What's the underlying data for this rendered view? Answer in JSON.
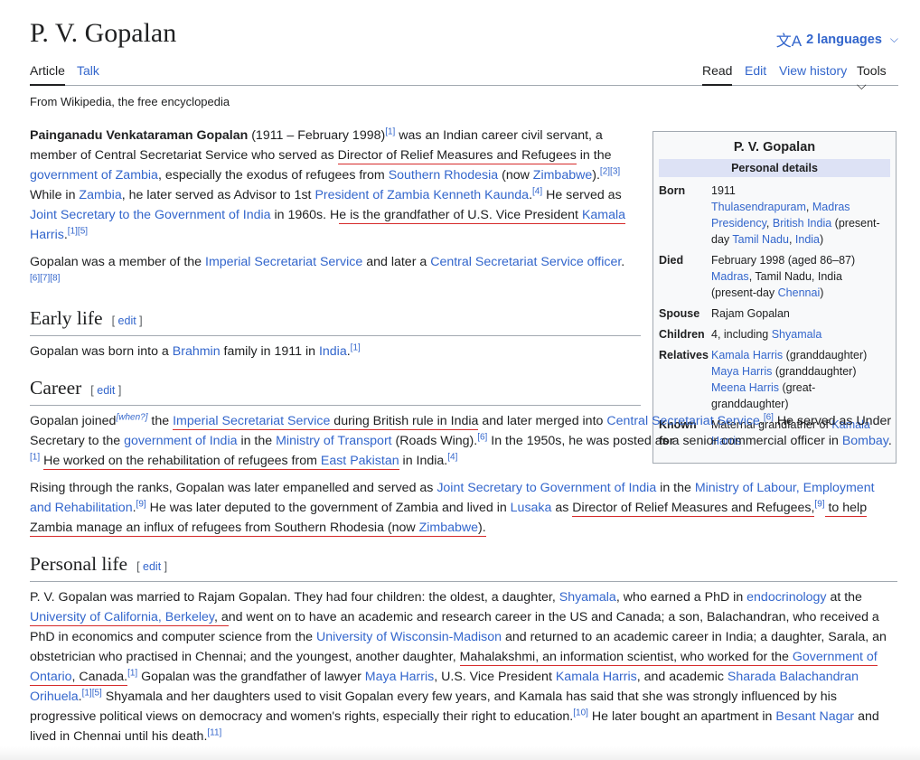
{
  "page": {
    "title": "P. V. Gopalan",
    "languages": "2 languages",
    "tagline": "From Wikipedia, the free encyclopedia"
  },
  "tabs": {
    "article": "Article",
    "talk": "Talk",
    "read": "Read",
    "edit": "Edit",
    "history": "View history",
    "tools": "Tools"
  },
  "lead": {
    "p1": [
      {
        "t": "Painganadu Venkataraman Gopalan",
        "b": true
      },
      {
        "t": " (1911 – February 1998)"
      },
      {
        "t": "[1]",
        "sup": true
      },
      {
        "t": " was an Indian career civil servant, a member of Central Secretariat Service who served as "
      },
      {
        "t": "Director of Relief Measures and Refugees",
        "u": true
      },
      {
        "t": " in the "
      },
      {
        "t": "government of Zambia",
        "l": true
      },
      {
        "t": ", especially the exodus of refugees from "
      },
      {
        "t": "Southern Rhodesia",
        "l": true
      },
      {
        "t": " (now "
      },
      {
        "t": "Zimbabwe",
        "l": true
      },
      {
        "t": ")."
      },
      {
        "t": "[2][3]",
        "sup": true
      },
      {
        "t": " While in "
      },
      {
        "t": "Zambia",
        "l": true
      },
      {
        "t": ", he later served as Advisor to 1st "
      },
      {
        "t": "President of Zambia Kenneth Kaunda",
        "l": true
      },
      {
        "t": ".",
        "x": true
      },
      {
        "t": "[4]",
        "sup": true
      },
      {
        "t": " He served as "
      },
      {
        "t": "Joint Secretary to the Government of India",
        "l": true
      },
      {
        "t": " in 1960s. H"
      },
      {
        "t": "e is the grandfather of U.S. Vice President ",
        "u": true
      },
      {
        "t": "Kamala",
        "l": true,
        "u": true
      },
      {
        "t": " "
      },
      {
        "t": "Harris",
        "l": true
      },
      {
        "t": "."
      },
      {
        "t": "[1][5]",
        "sup": true
      }
    ],
    "p2": [
      {
        "t": "Gopalan was a member of the "
      },
      {
        "t": "Imperial Secretariat Service",
        "l": true
      },
      {
        "t": " and later a "
      },
      {
        "t": "Central Secretariat Service officer",
        "l": true
      },
      {
        "t": "."
      },
      {
        "t": "[6][7][8]",
        "sup": true
      }
    ]
  },
  "sections": [
    {
      "heading": "Early life",
      "edit": "[ edit ]",
      "paras": [
        [
          {
            "t": "Gopalan was born into a "
          },
          {
            "t": "Brahmin",
            "l": true
          },
          {
            "t": " family in 1911 in "
          },
          {
            "t": "India",
            "l": true
          },
          {
            "t": "."
          },
          {
            "t": "[1]",
            "sup": true
          }
        ]
      ]
    },
    {
      "heading": "Career",
      "edit": "[ edit ]",
      "paras": [
        [
          {
            "t": "Gopalan joined"
          },
          {
            "t": "[when?]",
            "sup": true,
            "i": true
          },
          {
            "t": " the "
          },
          {
            "t": "Imperial Secretariat Service",
            "l": true,
            "u": true
          },
          {
            "t": " during British rule in India",
            "u": true
          },
          {
            "t": " and later merged into "
          },
          {
            "t": "Central Secretariat Service",
            "l": true
          },
          {
            "t": "."
          },
          {
            "t": "[6]",
            "sup": true
          },
          {
            "t": " He served as Under Secretary to the "
          },
          {
            "t": "government of India",
            "l": true
          },
          {
            "t": " in the "
          },
          {
            "t": "Ministry of Transport",
            "l": true
          },
          {
            "t": " (Roads Wing)."
          },
          {
            "t": "[6]",
            "sup": true
          },
          {
            "t": " In the 1950s, he was posted as a senior commercial officer in "
          },
          {
            "t": "Bombay",
            "l": true
          },
          {
            "t": "."
          },
          {
            "t": "[1]",
            "sup": true
          },
          {
            "t": " "
          },
          {
            "t": "He worked on the rehabilitation of refugees from ",
            "u": true
          },
          {
            "t": "East Pakistan",
            "l": true,
            "u": true
          },
          {
            "t": " in India."
          },
          {
            "t": "[4]",
            "sup": true
          }
        ],
        [
          {
            "t": "Rising through the ranks, Gopalan was later empanelled and served as "
          },
          {
            "t": "Joint Secretary to Government of India",
            "l": true
          },
          {
            "t": " in the "
          },
          {
            "t": "Ministry of Labour, Employment and Rehabilitation",
            "l": true
          },
          {
            "t": "."
          },
          {
            "t": "[9]",
            "sup": true
          },
          {
            "t": " He was later deputed to the government of Zambia and lived in "
          },
          {
            "t": "Lusaka",
            "l": true
          },
          {
            "t": " as "
          },
          {
            "t": "Director of Relief Measures and Refugees,",
            "u": true
          },
          {
            "t": "[9]",
            "sup": true
          },
          {
            "t": " to help Zambia manage an influx of refugees from Southern Rhodesia (now ",
            "u": true
          },
          {
            "t": "Zimbabwe",
            "l": true,
            "u": true
          },
          {
            "t": ").",
            "u": true
          }
        ]
      ]
    },
    {
      "heading": "Personal life",
      "edit": "[ edit ]",
      "paras": [
        [
          {
            "t": "P. V. Gopalan was married to Rajam Gopalan. They had four children: the oldest, a daughter, "
          },
          {
            "t": "Shyamala",
            "l": true
          },
          {
            "t": ", who earned a PhD in "
          },
          {
            "t": "endocrinology",
            "l": true
          },
          {
            "t": " at the "
          },
          {
            "t": "University of California, Berkeley",
            "l": true,
            "u": true
          },
          {
            "t": ", a",
            "u": true
          },
          {
            "t": "nd went on to have an academic and research career in the US and Canada; a son, Balachandran, who received a PhD in economics and computer science from the "
          },
          {
            "t": "University of Wisconsin-Madison",
            "l": true
          },
          {
            "t": " and returned to an academic career in India; a daughter, Sarala, an obstetrician who practised in Chennai; and the youngest, another daughter, "
          },
          {
            "t": "Mahalakshmi, an information scientist, who worked for the ",
            "u": true
          },
          {
            "t": "Government of Ontario",
            "l": true,
            "u": true
          },
          {
            "t": ", Canada.",
            "u": true
          },
          {
            "t": "[1]",
            "sup": true
          },
          {
            "t": " Gopalan was the grandfather of lawyer "
          },
          {
            "t": "Maya Harris",
            "l": true
          },
          {
            "t": ", U.S. Vice President "
          },
          {
            "t": "Kamala Harris",
            "l": true
          },
          {
            "t": ", and academic "
          },
          {
            "t": "Sharada Balachandran Orihuela",
            "l": true
          },
          {
            "t": "."
          },
          {
            "t": "[1][5]",
            "sup": true
          },
          {
            "t": " Shyamala and her daughters used to visit Gopalan every few years, and Kamala has said that she was strongly influenced by his progressive political views on democracy and women's rights, especially their right to education."
          },
          {
            "t": "[10]",
            "sup": true
          },
          {
            "t": " He later bought an apartment in "
          },
          {
            "t": "Besant Nagar",
            "l": true
          },
          {
            "t": " and lived in Chennai until his death."
          },
          {
            "t": "[11]",
            "sup": true
          }
        ]
      ]
    }
  ],
  "infobox": {
    "title": "P. V. Gopalan",
    "subheader": "Personal details",
    "rows": [
      {
        "k": "Born",
        "v": [
          {
            "t": "1911"
          },
          {
            "br": true
          },
          {
            "t": "Thulasendrapuram",
            "l": true
          },
          {
            "t": ", "
          },
          {
            "t": "Madras Presidency",
            "l": true
          },
          {
            "t": ", "
          },
          {
            "t": "British India",
            "l": true
          },
          {
            "t": " (present-day "
          },
          {
            "t": "Tamil Nadu",
            "l": true
          },
          {
            "t": ", "
          },
          {
            "t": "India",
            "l": true
          },
          {
            "t": ")"
          }
        ]
      },
      {
        "k": "Died",
        "v": [
          {
            "t": "February 1998 (aged 86–87)"
          },
          {
            "br": true
          },
          {
            "t": "Madras",
            "l": true
          },
          {
            "t": ", Tamil Nadu, India (present-day "
          },
          {
            "t": "Chennai",
            "l": true
          },
          {
            "t": ")"
          }
        ]
      },
      {
        "k": "Spouse",
        "v": [
          {
            "t": "Rajam Gopalan"
          }
        ]
      },
      {
        "k": "Children",
        "v": [
          {
            "t": "4, including "
          },
          {
            "t": "Shyamala",
            "l": true
          }
        ]
      },
      {
        "k": "Relatives",
        "v": [
          {
            "t": "Kamala Harris",
            "l": true
          },
          {
            "t": " (granddaughter)"
          },
          {
            "br": true
          },
          {
            "t": "Maya Harris",
            "l": true
          },
          {
            "t": " (granddaughter)"
          },
          {
            "br": true
          },
          {
            "t": "Meena Harris",
            "l": true
          },
          {
            "t": " (great-granddaughter)"
          }
        ]
      },
      {
        "k": "Known for",
        "v": [
          {
            "t": "Maternal grandfather of "
          },
          {
            "t": "Kamala Harris",
            "l": true
          }
        ]
      }
    ]
  }
}
